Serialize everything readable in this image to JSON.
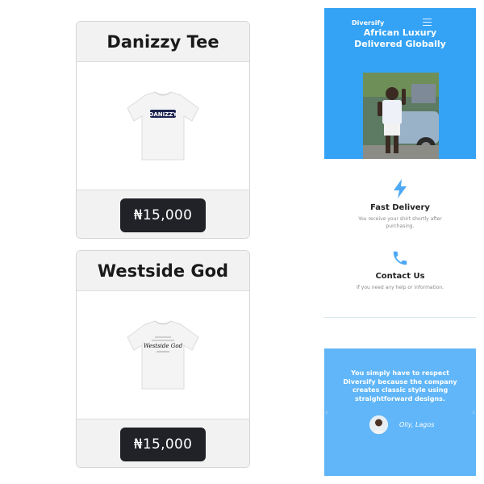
{
  "products": [
    {
      "title": "Danizzy Tee",
      "price": "₦15,000",
      "print_text": "DANIZZY"
    },
    {
      "title": "Westside God",
      "price": "₦15,000",
      "print_text": "Westside God"
    }
  ],
  "mobile": {
    "brand": "Diversify",
    "menu_icon": "hamburger-icon",
    "hero_title_line1": "African Luxury",
    "hero_title_line2": "Delivered Globally",
    "features": [
      {
        "icon": "lightning-icon",
        "title": "Fast Delivery",
        "text": "You receive your shirt shortly after purchasing."
      },
      {
        "icon": "phone-icon",
        "title": "Contact Us",
        "text": "If you need any help or information."
      }
    ],
    "testimonial": {
      "quote": "You simply have to respect Diversify because the company creates classic style using straightforward designs.",
      "author": "Olly, Lagos"
    }
  },
  "colors": {
    "hero_blue": "#34a2f5",
    "testimonial_blue": "#60b6f8",
    "price_button": "#202227",
    "icon_blue": "#4da8f5"
  }
}
